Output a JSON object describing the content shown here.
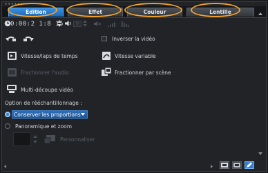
{
  "window": {
    "dots": "••••••••"
  },
  "tabs": [
    {
      "label": "Edition",
      "active": true
    },
    {
      "label": "Effet",
      "active": false
    },
    {
      "label": "Couleur",
      "active": false
    },
    {
      "label": "Lentille",
      "active": false
    }
  ],
  "duration": {
    "timecode": "0:00:2 1:8 15"
  },
  "volume": {
    "value": "0"
  },
  "options": {
    "inverser": "Inverser la vidéo",
    "vitesse_laps": "Vitesse/laps de temps",
    "vitesse_variable": "Vitesse variable",
    "fractionner_audio": "Fractionner l'audio",
    "fractionner_scene": "Fractionner par scène",
    "multi_decoupe": "Multi-découpe vidéo"
  },
  "resampling": {
    "heading": "Option de rééchantillonnage :",
    "conserver": "Conserver les proportions",
    "panoramique": "Panoramique et zoom",
    "personnaliser": "Personnaliser"
  },
  "colors": {
    "accent": "#2f7fd6",
    "highlight_ring": "#f0a32a"
  },
  "icons": [
    "clock-icon",
    "speaker-icon",
    "mute-icon",
    "volume-low-icon",
    "volume-high-icon",
    "rotate-left-icon",
    "rotate-right-icon",
    "film-speed-icon",
    "variable-speed-icon",
    "split-audio-icon",
    "split-scene-icon",
    "multi-trim-icon",
    "customize-icon"
  ]
}
